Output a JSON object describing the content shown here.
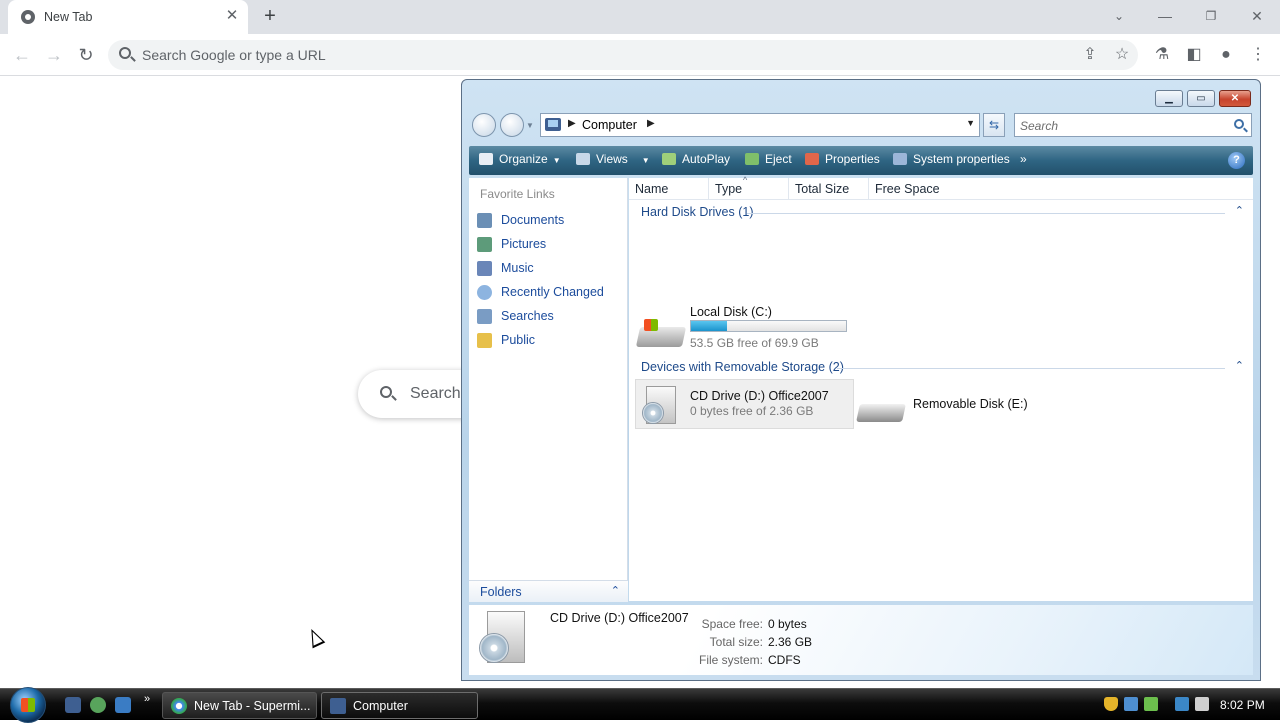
{
  "browser": {
    "tab_title": "New Tab",
    "close_glyph": "✕",
    "new_tab_glyph": "+",
    "omnibox_placeholder": "Search Google or type a URL",
    "ntp_search_placeholder": "Search",
    "icons": [
      "chrome-favicon",
      "back-arrow-icon",
      "forward-arrow-icon",
      "reload-icon",
      "share-icon",
      "star-icon",
      "extensions-icon",
      "side-panel-icon",
      "profile-icon",
      "more-menu-icon"
    ]
  },
  "explorer": {
    "address": {
      "location": "Computer"
    },
    "search_placeholder": "Search",
    "commands": [
      {
        "label": "Organize",
        "icon": "organize-icon"
      },
      {
        "label": "Views",
        "icon": "views-icon"
      },
      {
        "label": "AutoPlay",
        "icon": "autoplay-icon"
      },
      {
        "label": "Eject",
        "icon": "eject-icon"
      },
      {
        "label": "Properties",
        "icon": "properties-icon"
      },
      {
        "label": "System properties",
        "icon": "system-properties-icon"
      }
    ],
    "more_commands": "»",
    "help": "?",
    "nav": {
      "header": "Favorite Links",
      "items": [
        {
          "label": "Documents",
          "icon": "documents-icon",
          "color": "#6b8fb5"
        },
        {
          "label": "Pictures",
          "icon": "pictures-icon",
          "color": "#5d9b7a"
        },
        {
          "label": "Music",
          "icon": "music-icon",
          "color": "#6a86b8"
        },
        {
          "label": "Recently Changed",
          "icon": "recently-changed-icon",
          "color": "#8db4e0"
        },
        {
          "label": "Searches",
          "icon": "searches-icon",
          "color": "#7a9cc4"
        },
        {
          "label": "Public",
          "icon": "public-folder-icon",
          "color": "#e7c04a"
        }
      ],
      "folders_label": "Folders"
    },
    "columns": [
      "Name",
      "Type",
      "Total Size",
      "Free Space"
    ],
    "groups": [
      {
        "title": "Hard Disk Drives (1)",
        "drives": [
          {
            "name": "Local Disk (C:)",
            "detail": "53.5 GB free of 69.9 GB",
            "used_fraction": 0.235
          }
        ]
      },
      {
        "title": "Devices with Removable Storage (2)",
        "drives": [
          {
            "name": "CD Drive (D:) Office2007",
            "detail": "0 bytes free of 2.36 GB"
          },
          {
            "name": "Removable Disk (E:)"
          }
        ]
      }
    ],
    "details_pane": {
      "name": "CD Drive (D:) Office2007",
      "space_free_label": "Space free:",
      "space_free": "0 bytes",
      "total_size_label": "Total size:",
      "total_size": "2.36 GB",
      "file_system_label": "File system:",
      "file_system": "CDFS"
    }
  },
  "taskbar": {
    "buttons": [
      {
        "label": "New Tab - Supermi...",
        "icon": "chrome-icon"
      },
      {
        "label": "Computer",
        "icon": "computer-icon"
      }
    ],
    "clock": "8:02 PM"
  }
}
